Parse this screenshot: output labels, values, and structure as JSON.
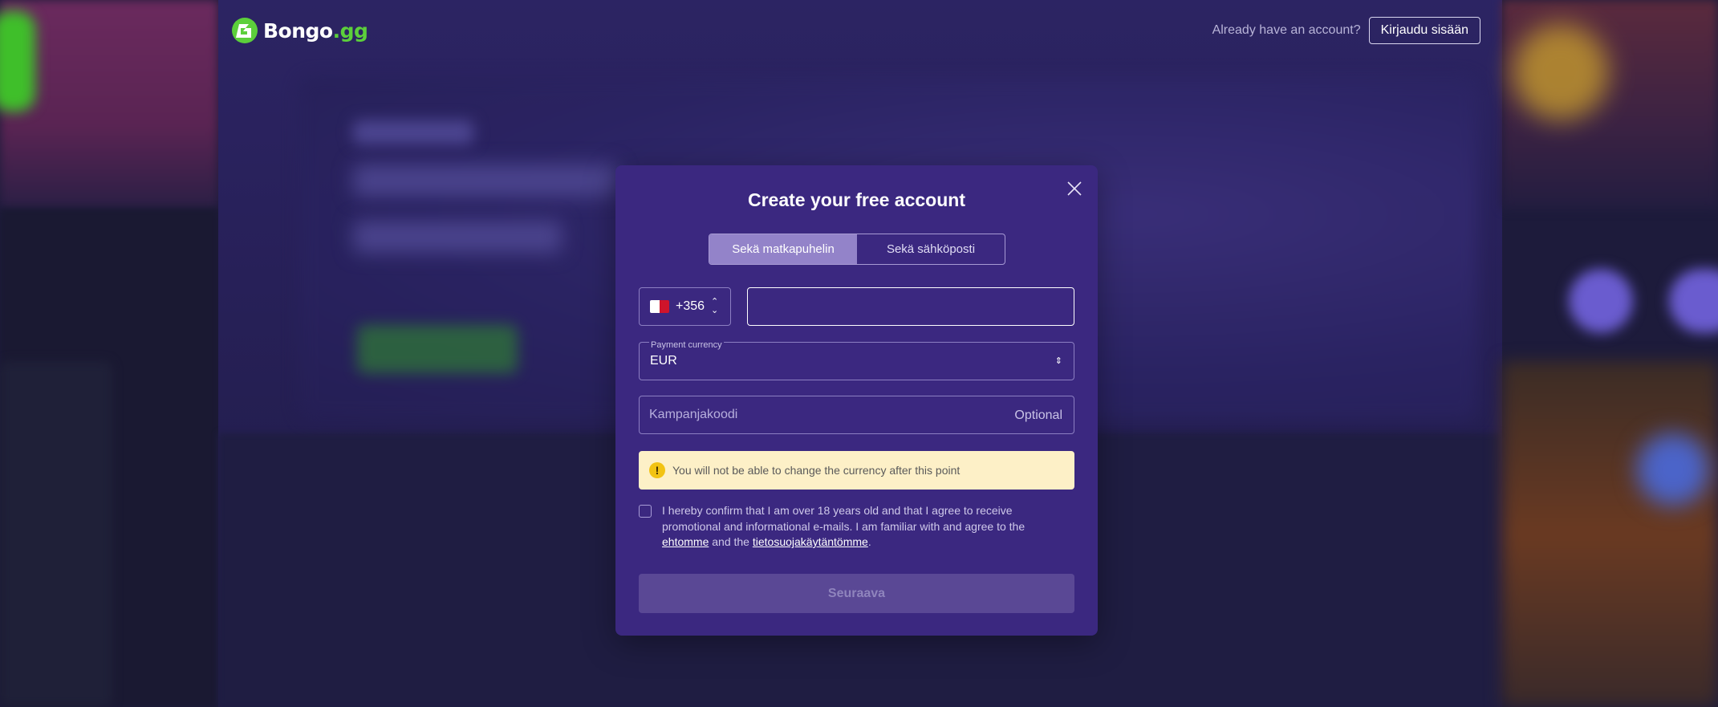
{
  "header": {
    "brand_name": "Bongo",
    "brand_suffix": ".gg",
    "have_account_text": "Already have an account?",
    "login_button": "Kirjaudu sisään"
  },
  "modal": {
    "title": "Create your free account",
    "tabs": [
      {
        "label": "Sekä matkapuhelin",
        "active": true
      },
      {
        "label": "Sekä sähköposti",
        "active": false
      }
    ],
    "phone": {
      "country_code": "+356",
      "country_flag": "malta-flag-icon",
      "value": ""
    },
    "currency": {
      "label": "Payment currency",
      "value": "EUR"
    },
    "promo": {
      "placeholder": "Kampanjakoodi",
      "optional_label": "Optional"
    },
    "warning": {
      "icon": "!",
      "text": "You will not be able to change the currency after this point"
    },
    "consent": {
      "checked": false,
      "text_part1": "I hereby confirm that I am over 18 years old and that I agree to receive promotional and informational e-mails. I am familiar with and agree to the",
      "terms_link": "ehtomme",
      "and_text": "and the",
      "privacy_link": "tietosuojakäytäntömme",
      "end": "."
    },
    "submit_label": "Seuraava"
  },
  "colors": {
    "modal_bg": "#3b2880",
    "active_tab": "#9383c9",
    "warning_bg": "#fdf0c7",
    "warning_icon": "#f2c313",
    "brand_green": "#5ccf3b",
    "disabled_button": "#5a4895"
  }
}
